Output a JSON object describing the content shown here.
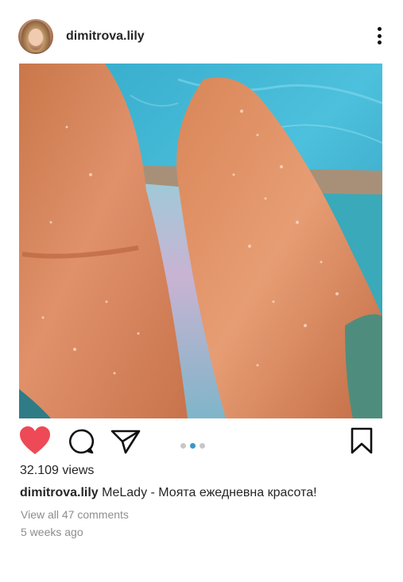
{
  "post": {
    "author": {
      "username": "dimitrova.lily"
    },
    "photo": {
      "description_icon": "photo"
    },
    "carousel": {
      "count": 3,
      "active_index": 1
    },
    "stats": {
      "views_text": "32.109 views"
    },
    "caption": {
      "username": "dimitrova.lily",
      "text": "MeLady - Моята ежедневна красота!"
    },
    "comments_link": "View all 47 comments",
    "timestamp": "5 weeks ago"
  },
  "actions": {
    "like": {
      "icon": "heart-icon",
      "liked": true,
      "color": "#ed4956"
    },
    "comment": {
      "icon": "comment-icon"
    },
    "share": {
      "icon": "paper-plane-icon"
    },
    "save": {
      "icon": "bookmark-icon"
    }
  },
  "colors": {
    "carousel_active": "#3897c6",
    "carousel_inactive": "#c7c7c7",
    "muted_text": "#8e8e8e"
  }
}
